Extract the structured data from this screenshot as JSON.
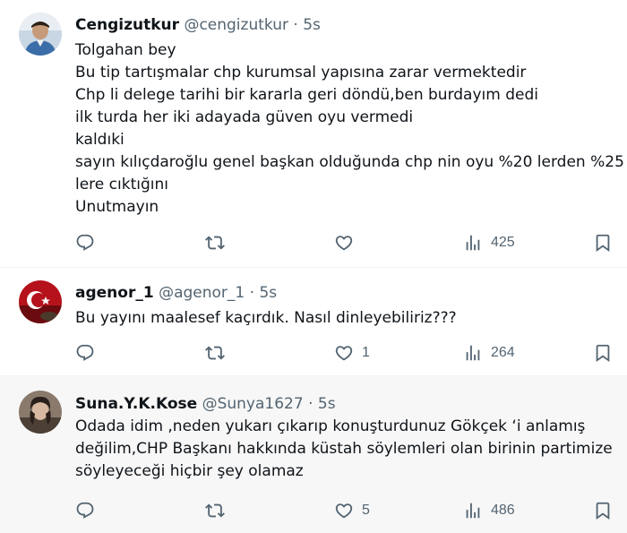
{
  "tweets": [
    {
      "name": "Cengizutkur",
      "handle": "@cengizutkur",
      "time": "5s",
      "lines": [
        "Tolgahan bey",
        "Bu tip tartışmalar chp kurumsal yapısına zarar vermektedir",
        "Chp li delege tarihi bir kararla geri döndü,ben burdayım dedi",
        "ilk turda her iki adayada güven oyu vermedi",
        "kaldıki",
        "sayın kılıçdaroğlu genel başkan olduğunda chp nin oyu %20 lerden %25",
        "lere cıktığını",
        "Unutmayın"
      ],
      "likes": "",
      "views": "425"
    },
    {
      "name": "agenor_1",
      "handle": "@agenor_1",
      "time": "5s",
      "lines": [
        "Bu yayını maalesef kaçırdık. Nasıl dinleyebiliriz???"
      ],
      "likes": "1",
      "views": "264"
    },
    {
      "name": "Suna.Y.K.Kose",
      "handle": "@Sunya1627",
      "time": "5s",
      "lines": [
        "Odada idim ,neden yukarı çıkarıp konuşturdunuz Gökçek ‘i anlamış",
        "değilim,CHP Başkanı hakkında küstah söylemleri olan birinin partimize",
        "söyleyeceği hiçbir şey olamaz"
      ],
      "likes": "5",
      "views": "486"
    }
  ],
  "separator": "·",
  "colors": {
    "text": "#0f1419",
    "secondary": "#536471",
    "highlight_bg": "#f7f7f7"
  },
  "icons": [
    "reply-icon",
    "retweet-icon",
    "like-icon",
    "views-icon",
    "bookmark-icon"
  ]
}
